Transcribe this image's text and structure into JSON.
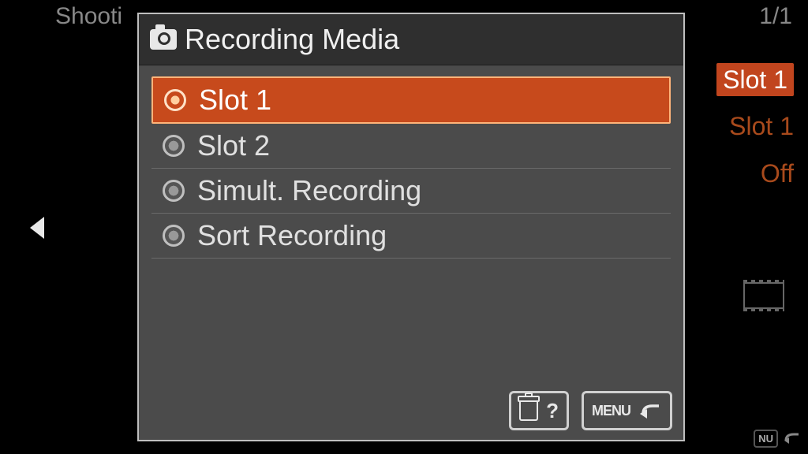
{
  "background": {
    "top_left_hint": "Shooti",
    "page_indicator": "1/1",
    "right_values": [
      "Slot 1",
      "Slot 1",
      "Off"
    ],
    "bottom_right_label": "NU"
  },
  "dialog": {
    "title": "Recording Media",
    "options": [
      {
        "label": "Slot 1",
        "selected": true
      },
      {
        "label": "Slot 2",
        "selected": false
      },
      {
        "label": "Simult. Recording",
        "selected": false
      },
      {
        "label": "Sort Recording",
        "selected": false
      }
    ],
    "footer": {
      "help_symbol": "?",
      "menu_label": "MENU"
    }
  }
}
